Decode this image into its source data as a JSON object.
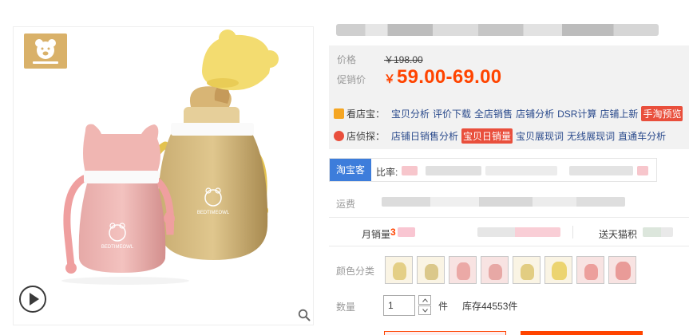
{
  "gallery": {
    "logo_icon": "bear-face-icon",
    "play_icon": "play-circle-icon",
    "zoom_icon": "search-icon"
  },
  "product": {
    "title_redacted": true
  },
  "price": {
    "price_label": "价格",
    "original_price": "￥198.00",
    "promo_label": "促销价",
    "currency": "￥",
    "promo_value": "59.00-69.00",
    "accent_color": "#ff4400"
  },
  "shop_tools": {
    "row1_label": "看店宝：",
    "row1_links": [
      "宝贝分析",
      "评价下载",
      "全店销售",
      "店铺分析",
      "DSR计算",
      "店铺上新"
    ],
    "row1_highlight": "手淘预览",
    "row2_label": "店侦探：",
    "row2_links_before": [
      "店铺日销售分析"
    ],
    "row2_highlight": "宝贝日销量",
    "row2_links_after": [
      "宝贝展现词",
      "无线展现词",
      "直通车分析"
    ],
    "highlight_color": "#e94f3c"
  },
  "compare": {
    "tab_label": "淘宝客",
    "label": "比率:",
    "tab_color": "#3d7ddb"
  },
  "shipping": {
    "label": "运费"
  },
  "stats": {
    "monthly_sales_label": "月销量",
    "monthly_sales_prefix": "3",
    "reward_label": "送天猫积"
  },
  "sku": {
    "label": "颜色分类",
    "options": [
      "sku-yellow-bottle",
      "sku-yellow-cup",
      "sku-pink-bottle",
      "sku-pink-cup",
      "sku-yellow-handle",
      "sku-yellow-set",
      "sku-pink-handle",
      "sku-pink-set"
    ]
  },
  "quantity": {
    "label": "数量",
    "value": "1",
    "unit": "件",
    "stock": "库存44553件"
  }
}
